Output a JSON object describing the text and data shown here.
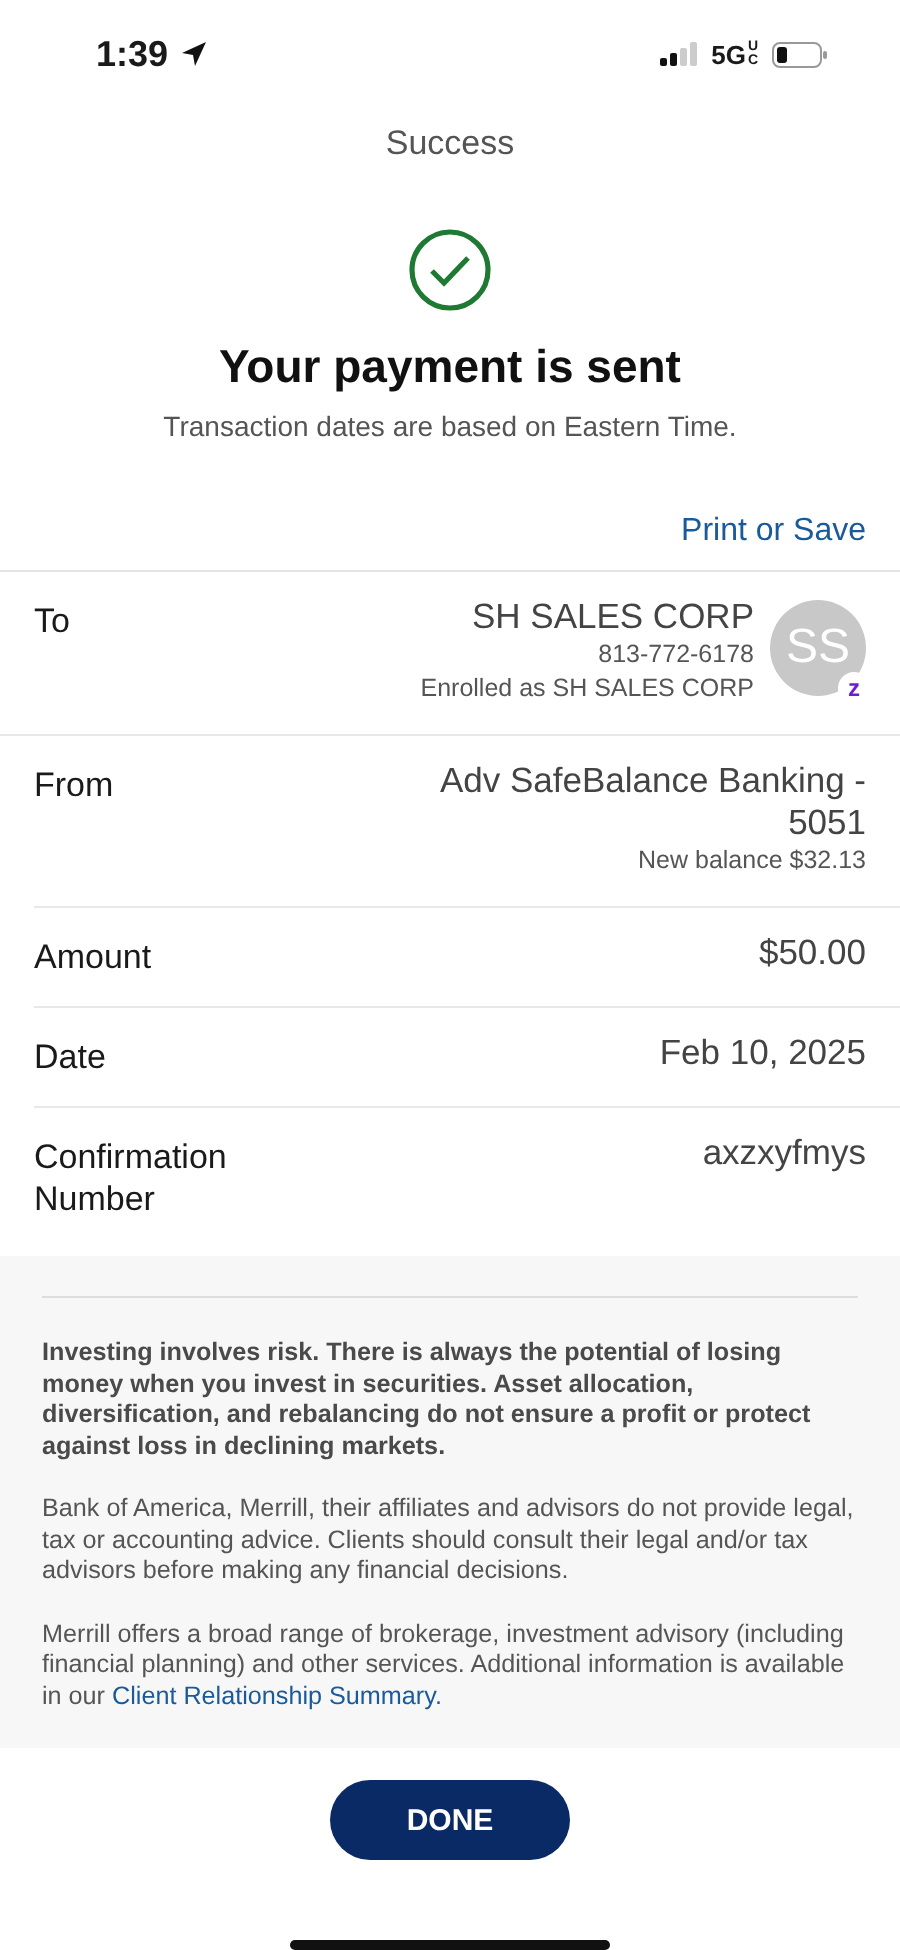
{
  "status_bar": {
    "time": "1:39",
    "network": "5G",
    "network_suffix": "UC"
  },
  "header": {
    "title": "Success"
  },
  "confirmation": {
    "heading": "Your payment is sent",
    "subtitle": "Transaction dates are based on Eastern Time.",
    "print_link": "Print or Save"
  },
  "details": [
    {
      "label": "To",
      "values": [
        {
          "kind": "primary",
          "text": "SH SALES CORP"
        },
        {
          "kind": "secondary",
          "text": "813-772-6178"
        },
        {
          "kind": "secondary",
          "text": "Enrolled as SH SALES CORP"
        }
      ],
      "avatar": {
        "initials": "SS",
        "badge": "z"
      }
    },
    {
      "label": "From",
      "values": [
        {
          "kind": "primary",
          "text": "Adv SafeBalance Banking - 5051"
        },
        {
          "kind": "secondary",
          "text": "New balance $32.13"
        }
      ]
    },
    {
      "label": "Amount",
      "values": [
        {
          "kind": "primary",
          "text": "$50.00"
        }
      ]
    },
    {
      "label": "Date",
      "values": [
        {
          "kind": "primary",
          "text": "Feb 10, 2025"
        }
      ]
    },
    {
      "label": "Confirmation Number",
      "values": [
        {
          "kind": "primary",
          "text": "axzxyfmys"
        }
      ]
    }
  ],
  "disclosures": [
    {
      "kind": "bold",
      "text": "Investing involves risk. There is always the potential of losing money when you invest in securities. Asset allocation, diversification, and rebalancing do not ensure a profit or protect against loss in declining markets."
    },
    {
      "kind": "plain",
      "text": "Bank of America, Merrill, their affiliates and advisors do not provide legal, tax or accounting advice. Clients should consult their legal and/or tax advisors before making any financial decisions."
    },
    {
      "kind": "plain",
      "text": "Merrill offers a broad range of brokerage, investment advisory (including financial planning) and other services. Additional information is available in our",
      "link": "Client Relationship Summary."
    }
  ],
  "done_button": "DONE"
}
